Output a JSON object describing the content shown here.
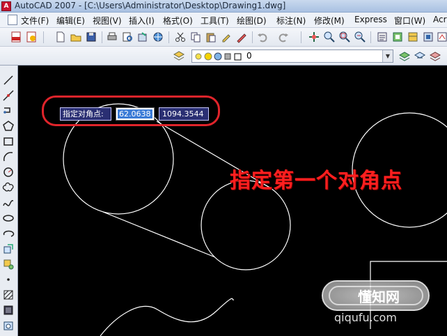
{
  "window": {
    "title": "AutoCAD 2007 - [C:\\Users\\Administrator\\Desktop\\Drawing1.dwg]",
    "app_icon_glyph": "A"
  },
  "menu": {
    "items": [
      "文件(F)",
      "编辑(E)",
      "视图(V)",
      "插入(I)",
      "格式(O)",
      "工具(T)",
      "绘图(D)",
      "标注(N)",
      "修改(M)",
      "Express",
      "窗口(W)",
      "Acr"
    ]
  },
  "layer_toolbar": {
    "current_layer": "0"
  },
  "dynamic_input": {
    "prompt": "指定对角点:",
    "x_value": "62.0638",
    "y_value": "1094.3544"
  },
  "annotation": {
    "text": "指定第一个对角点"
  },
  "watermark": {
    "logo_text": "懂知网",
    "url_text": "qiqufu.com"
  },
  "colors": {
    "annotation_red": "#e0242b",
    "canvas_bg": "#000000",
    "dyn_input_bg": "#2a2f73"
  }
}
